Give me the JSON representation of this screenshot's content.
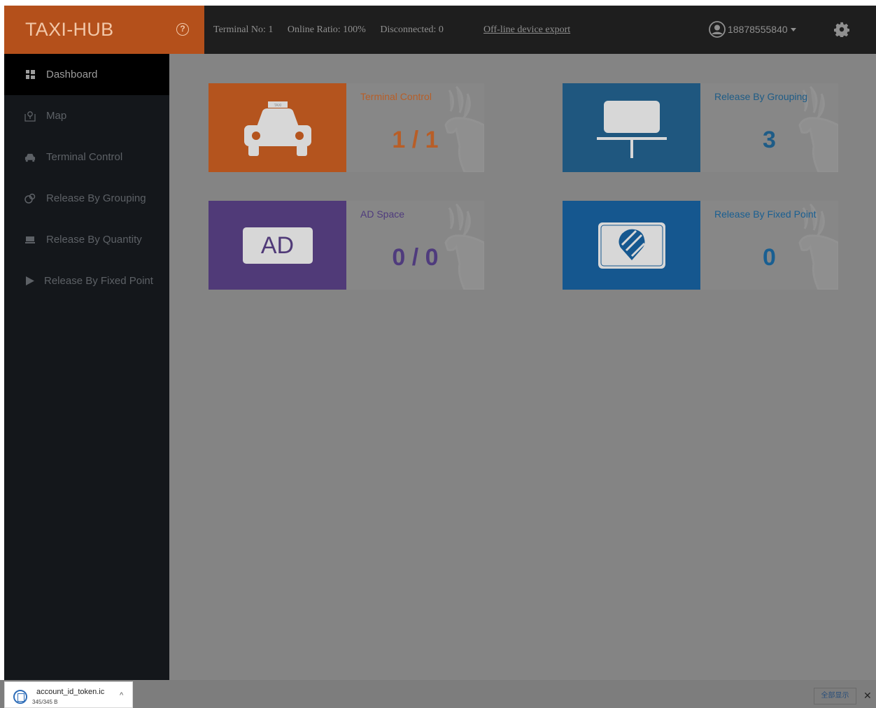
{
  "header": {
    "brand": "TAXI-HUB",
    "help_icon": "?",
    "stats": {
      "terminal_no": "Terminal No:  1",
      "online_ratio": "Online Ratio:  100%",
      "disconnected": "Disconnected:  0"
    },
    "export_link": "Off-line device export",
    "username": "18878555840"
  },
  "sidebar": {
    "items": [
      {
        "label": "Dashboard",
        "icon": "dashboard-icon"
      },
      {
        "label": "Map",
        "icon": "map-icon"
      },
      {
        "label": "Terminal Control",
        "icon": "car-icon"
      },
      {
        "label": "Release By Grouping",
        "icon": "group-icon"
      },
      {
        "label": "Release By Quantity",
        "icon": "quantity-icon"
      },
      {
        "label": "Release By Fixed Point",
        "icon": "play-icon"
      }
    ]
  },
  "cards": [
    {
      "title": "Terminal Control",
      "value": "1 / 1",
      "color": "#b4541e",
      "value_color": "#b85e27",
      "icon": "taxi-icon"
    },
    {
      "title": "Release By Grouping",
      "value": "3",
      "color": "#1f577f",
      "value_color": "#1e5c87",
      "icon": "display-board-icon"
    },
    {
      "title": "AD Space",
      "value": "0 / 0",
      "color": "#503a78",
      "value_color": "#4f3b7d",
      "icon": "ad-icon",
      "icon_text": "AD"
    },
    {
      "title": "Release By Fixed Point",
      "value": "0",
      "color": "#15578f",
      "value_color": "#195f92",
      "icon": "location-tag-icon"
    }
  ],
  "download_bar": {
    "file_name": "account_id_token.ic",
    "file_size": "345/345 B",
    "show_all": "全部显示",
    "close": "✕",
    "chevron": "^"
  }
}
